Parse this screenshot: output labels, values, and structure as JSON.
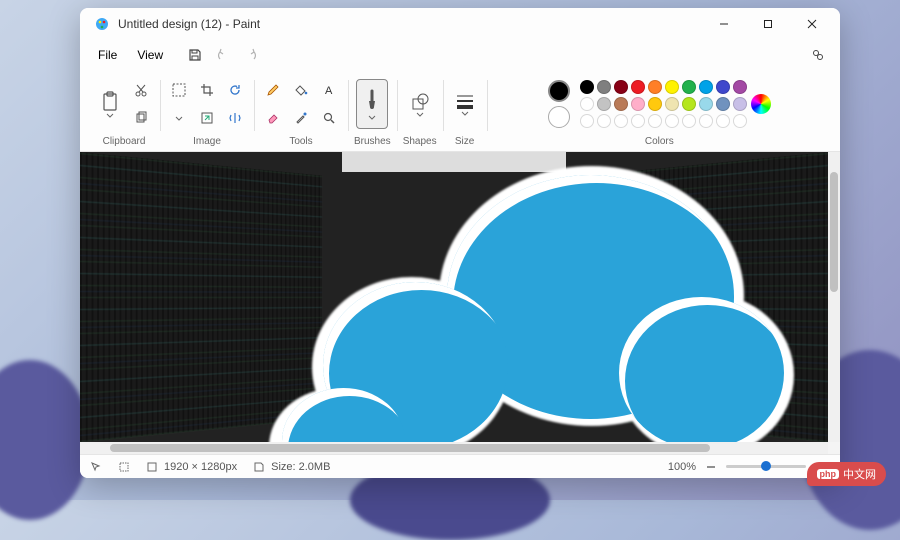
{
  "window": {
    "title": "Untitled design (12) - Paint"
  },
  "menubar": {
    "file": "File",
    "view": "View"
  },
  "ribbon": {
    "groups": {
      "clipboard": "Clipboard",
      "image": "Image",
      "tools": "Tools",
      "brushes": "Brushes",
      "shapes": "Shapes",
      "size": "Size",
      "colors": "Colors"
    }
  },
  "colors": {
    "current_primary": "#000000",
    "current_secondary": "#ffffff",
    "row1": [
      "#000000",
      "#7f7f7f",
      "#880015",
      "#ed1c24",
      "#ff7f27",
      "#fff200",
      "#22b14c",
      "#00a2e8",
      "#3f48cc",
      "#a349a4"
    ],
    "row2": [
      "#ffffff",
      "#c3c3c3",
      "#b97a57",
      "#ffaec9",
      "#ffc90e",
      "#efe4b0",
      "#b5e61d",
      "#99d9ea",
      "#7092be",
      "#c8bfe7"
    ],
    "row3_empty_count": 10
  },
  "statusbar": {
    "dimensions": "1920 × 1280px",
    "size": "Size: 2.0MB",
    "zoom": "100%"
  },
  "watermark": {
    "badge": "php",
    "text": "中文网"
  }
}
